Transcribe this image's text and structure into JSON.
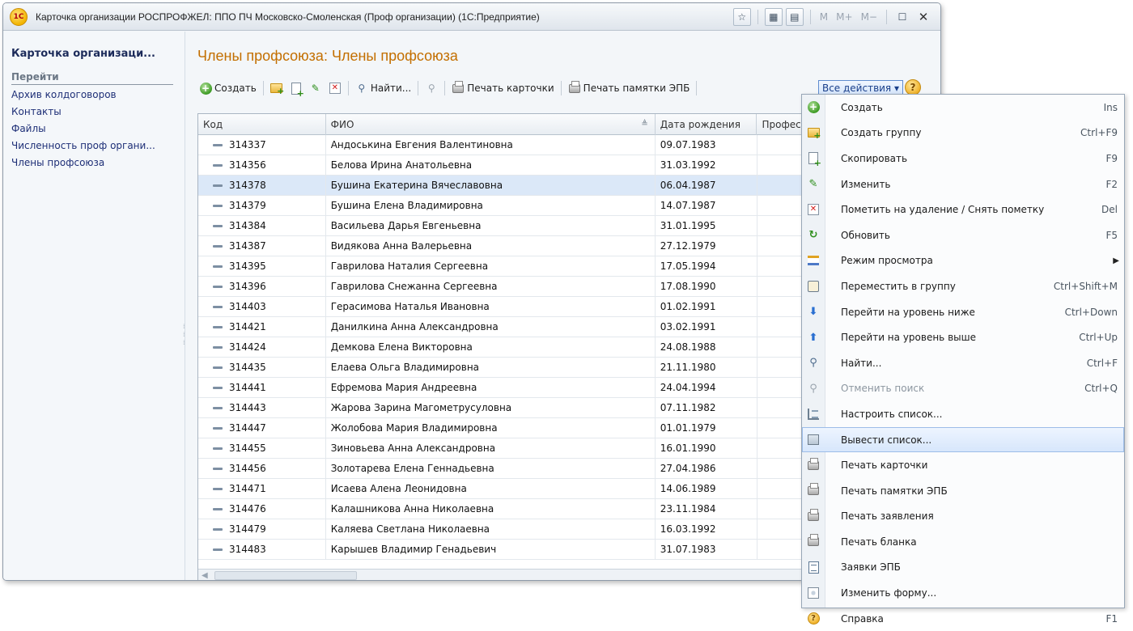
{
  "window": {
    "title": "Карточка организации РОСПРОФЖЕЛ: ППО ПЧ Московско-Смоленская (Проф организации)  (1С:Предприятие)",
    "logo_text": "1С",
    "tool_m": "M",
    "tool_mplus": "M+",
    "tool_mminus": "M−"
  },
  "left": {
    "title": "Карточка организаци...",
    "section": "Перейти",
    "links": [
      "Архив колдоговоров",
      "Контакты",
      "Файлы",
      "Численность проф органи...",
      "Члены профсоюза"
    ]
  },
  "main": {
    "title": "Члены профсоюза: Члены профсоюза",
    "toolbar": {
      "create": "Создать",
      "find": "Найти...",
      "print_card": "Печать карточки",
      "print_epb": "Печать памятки ЭПБ",
      "all_actions": "Все действия ▾",
      "help": "?"
    }
  },
  "table": {
    "columns": [
      "Код",
      "ФИО",
      "Дата рождения",
      "Професс"
    ],
    "selected_index": 2,
    "rows": [
      {
        "code": "314337",
        "fio": "Андоськина Евгения Валентиновна",
        "date": "09.07.1983"
      },
      {
        "code": "314356",
        "fio": "Белова Ирина Анатольевна",
        "date": "31.03.1992"
      },
      {
        "code": "314378",
        "fio": "Бушина Екатерина Вячеславовна",
        "date": "06.04.1987"
      },
      {
        "code": "314379",
        "fio": "Бушина Елена Владимировна",
        "date": "14.07.1987"
      },
      {
        "code": "314384",
        "fio": "Васильева Дарья Евгеньевна",
        "date": "31.01.1995"
      },
      {
        "code": "314387",
        "fio": "Видякова Анна Валерьевна",
        "date": "27.12.1979"
      },
      {
        "code": "314395",
        "fio": "Гаврилова Наталия Сергеевна",
        "date": "17.05.1994"
      },
      {
        "code": "314396",
        "fio": "Гаврилова Снежанна Сергеевна",
        "date": "17.08.1990"
      },
      {
        "code": "314403",
        "fio": "Герасимова Наталья Ивановна",
        "date": "01.02.1991"
      },
      {
        "code": "314421",
        "fio": "Данилкина Анна Александровна",
        "date": "03.02.1991"
      },
      {
        "code": "314424",
        "fio": "Демкова Елена Викторовна",
        "date": "24.08.1988"
      },
      {
        "code": "314435",
        "fio": "Елаева Ольга Владимировна",
        "date": "21.11.1980"
      },
      {
        "code": "314441",
        "fio": "Ефремова Мария Андреевна",
        "date": "24.04.1994"
      },
      {
        "code": "314443",
        "fio": "Жарова Зарина Магометрусуловна",
        "date": "07.11.1982"
      },
      {
        "code": "314447",
        "fio": "Жолобова Мария Владимировна",
        "date": "01.01.1979"
      },
      {
        "code": "314455",
        "fio": "Зиновьева  Анна  Александровна",
        "date": "16.01.1990"
      },
      {
        "code": "314456",
        "fio": "Золотарева Елена Геннадьевна",
        "date": "27.04.1986"
      },
      {
        "code": "314471",
        "fio": "Исаева Алена Леонидовна",
        "date": "14.06.1989"
      },
      {
        "code": "314476",
        "fio": "Калашникова Анна Николаевна",
        "date": "23.11.1984"
      },
      {
        "code": "314479",
        "fio": "Каляева Светлана Николаевна",
        "date": "16.03.1992"
      },
      {
        "code": "314483",
        "fio": "Карышев Владимир Генадьевич",
        "date": "31.07.1983"
      }
    ]
  },
  "menu": {
    "highlighted_index": 13,
    "items": [
      {
        "label": "Создать",
        "shortcut": "Ins",
        "icon": "create-icon"
      },
      {
        "label": "Создать группу",
        "shortcut": "Ctrl+F9",
        "icon": "create-group-icon"
      },
      {
        "label": "Скопировать",
        "shortcut": "F9",
        "icon": "copy-icon"
      },
      {
        "label": "Изменить",
        "shortcut": "F2",
        "icon": "edit-icon"
      },
      {
        "label": "Пометить на удаление / Снять пометку",
        "shortcut": "Del",
        "icon": "delete-mark-icon"
      },
      {
        "label": "Обновить",
        "shortcut": "F5",
        "icon": "refresh-icon"
      },
      {
        "label": "Режим просмотра",
        "shortcut": "",
        "icon": "view-mode-icon",
        "submenu": true
      },
      {
        "label": "Переместить в группу",
        "shortcut": "Ctrl+Shift+M",
        "icon": "move-to-group-icon"
      },
      {
        "label": "Перейти на уровень ниже",
        "shortcut": "Ctrl+Down",
        "icon": "level-down-icon"
      },
      {
        "label": "Перейти на уровень выше",
        "shortcut": "Ctrl+Up",
        "icon": "level-up-icon"
      },
      {
        "label": "Найти...",
        "shortcut": "Ctrl+F",
        "icon": "find-icon"
      },
      {
        "label": "Отменить поиск",
        "shortcut": "Ctrl+Q",
        "icon": "cancel-search-icon",
        "disabled": true
      },
      {
        "label": "Настроить список...",
        "shortcut": "",
        "icon": "configure-list-icon"
      },
      {
        "label": "Вывести список...",
        "shortcut": "",
        "icon": "output-list-icon"
      },
      {
        "label": "Печать карточки",
        "shortcut": "",
        "icon": "printer-icon"
      },
      {
        "label": "Печать памятки ЭПБ",
        "shortcut": "",
        "icon": "printer-icon"
      },
      {
        "label": "Печать заявления",
        "shortcut": "",
        "icon": "printer-icon"
      },
      {
        "label": "Печать бланка",
        "shortcut": "",
        "icon": "printer-icon"
      },
      {
        "label": "Заявки ЭПБ",
        "shortcut": "",
        "icon": "epb-requests-icon"
      },
      {
        "label": "Изменить форму...",
        "shortcut": "",
        "icon": "edit-form-icon"
      },
      {
        "label": "Справка",
        "shortcut": "F1",
        "icon": "help-icon"
      }
    ]
  }
}
